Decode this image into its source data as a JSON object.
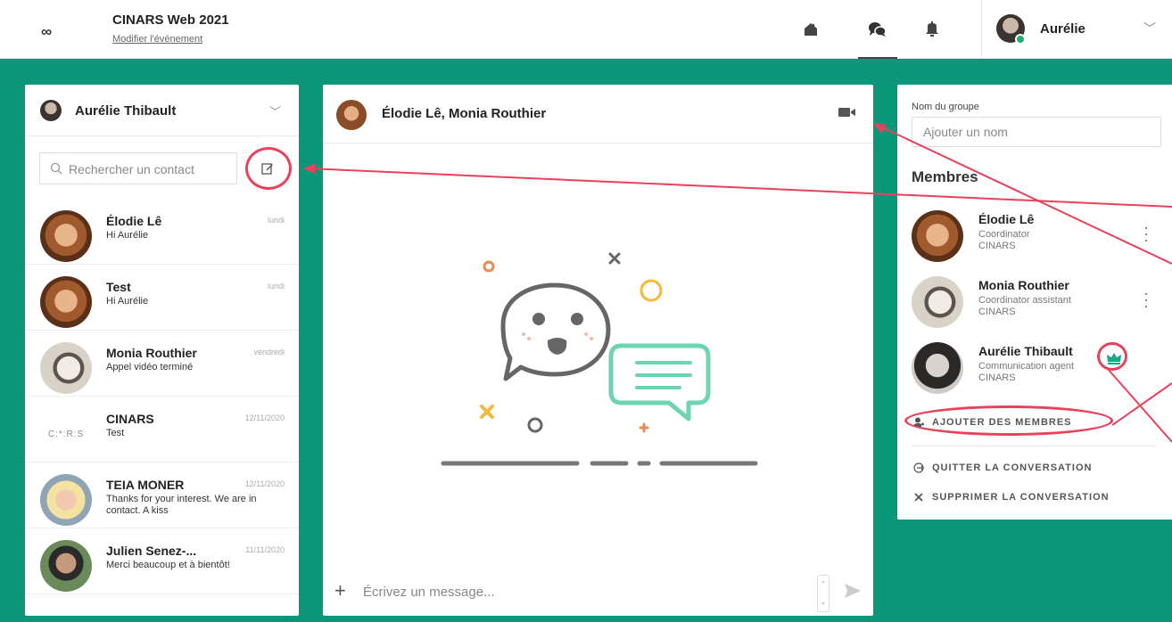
{
  "header": {
    "logo": "∞",
    "event_title": "CINARS Web 2021",
    "event_edit_link": "Modifier l'événement",
    "user_name": "Aurélie"
  },
  "sidebar": {
    "account_name": "Aurélie Thibault",
    "search_placeholder": "Rechercher un contact",
    "contacts": [
      {
        "name": "Élodie Lê",
        "message": "Hi Aurélie",
        "date": "lundi"
      },
      {
        "name": "Test",
        "message": "Hi Aurélie",
        "date": "lundi"
      },
      {
        "name": "Monia Routhier",
        "message": "Appel vidéo terminé",
        "date": "vendredi"
      },
      {
        "name": "CINARS",
        "message": "Test",
        "date": "12/11/2020"
      },
      {
        "name": "TEIA MONER",
        "message": "Thanks for your interest. We are in contact. A kiss",
        "date": "12/11/2020"
      },
      {
        "name": "Julien Senez-...",
        "message": "Merci beaucoup et à bientôt!",
        "date": "11/11/2020"
      }
    ]
  },
  "conversation": {
    "title": "Élodie Lê, Monia Routhier",
    "message_placeholder": "Écrivez un message..."
  },
  "group": {
    "name_label": "Nom du groupe",
    "name_placeholder": "Ajouter un nom",
    "members_title": "Membres",
    "members": [
      {
        "name": "Élodie Lê",
        "role": "Coordinator",
        "org": "CINARS"
      },
      {
        "name": "Monia Routhier",
        "role": "Coordinator assistant",
        "org": "CINARS"
      },
      {
        "name": "Aurélie Thibault",
        "role": "Communication agent",
        "org": "CINARS"
      }
    ],
    "add_members": "AJOUTER DES MEMBRES",
    "leave": "QUITTER LA CONVERSATION",
    "delete": "SUPPRIMER LA CONVERSATION"
  },
  "colors": {
    "teal": "#0a9679",
    "annotation_red": "#e8415a",
    "crown_green": "#1aa985",
    "online_green": "#21b074"
  }
}
